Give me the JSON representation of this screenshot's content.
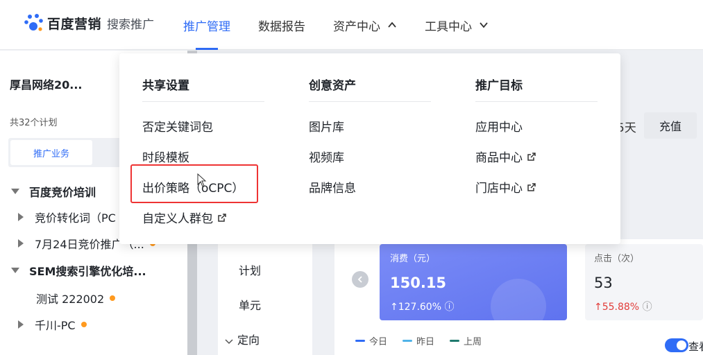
{
  "brand": {
    "name": "百度营销",
    "product": "搜索推广",
    "logo_icon": "baidu-paw-icon",
    "accent": "#2f6cf6"
  },
  "nav": {
    "items": [
      {
        "label": "推广管理",
        "active": true
      },
      {
        "label": "数据报告",
        "active": false
      },
      {
        "label": "资产中心",
        "active": false,
        "caret": "chevron-up-icon"
      },
      {
        "label": "工具中心",
        "active": false,
        "caret": "chevron-down-icon"
      }
    ]
  },
  "sidebar": {
    "account": "厚昌网络20...",
    "plan_count": "共32个计划",
    "tab_active": "推广业务",
    "tree": [
      {
        "label": "百度竞价培训",
        "level": 0,
        "expanded": true,
        "bold": true
      },
      {
        "label": "竞价转化词（PC",
        "level": 1,
        "expanded": false
      },
      {
        "label": "7月24日竞价推广（...",
        "level": 1,
        "expanded": false,
        "dot": true
      },
      {
        "label": "SEM搜索引擎优化培...",
        "level": 0,
        "expanded": true,
        "bold": true
      },
      {
        "label": "测试 222002",
        "level": 2,
        "dot": true
      },
      {
        "label": "千川-PC",
        "level": 1,
        "expanded": false,
        "dot": true
      }
    ]
  },
  "dropdown": {
    "columns": [
      {
        "heading": "共享设置",
        "links": [
          {
            "label": "否定关键词包",
            "external": false
          },
          {
            "label": "时段模板",
            "external": false
          },
          {
            "label": "出价策略（oCPC）",
            "external": false,
            "highlighted": true
          },
          {
            "label": "自定义人群包",
            "external": true
          }
        ]
      },
      {
        "heading": "创意资产",
        "links": [
          {
            "label": "图片库",
            "external": false
          },
          {
            "label": "视频库",
            "external": false
          },
          {
            "label": "品牌信息",
            "external": false
          }
        ]
      },
      {
        "heading": "推广目标",
        "links": [
          {
            "label": "应用中心",
            "external": false
          },
          {
            "label": "商品中心",
            "external": true
          },
          {
            "label": "门店中心",
            "external": true
          }
        ]
      }
    ]
  },
  "content": {
    "days_partial": "5天",
    "recharge_label": "充值",
    "subnav": [
      "计划",
      "单元",
      "定向"
    ],
    "cards": {
      "cost": {
        "label": "消费（元）",
        "value": "150.15",
        "change": "↑127.60%",
        "info_icon": "info-icon"
      },
      "clicks": {
        "label": "点击（次）",
        "value": "53",
        "change": "↑55.88%",
        "info_icon": "info-icon"
      }
    },
    "legend": [
      {
        "label": "今日",
        "color": "#2f6cf6"
      },
      {
        "label": "昨日",
        "color": "#4fb3e8"
      },
      {
        "label": "上周",
        "color": "#1f7a6e"
      }
    ],
    "toggle_label": "查看"
  }
}
